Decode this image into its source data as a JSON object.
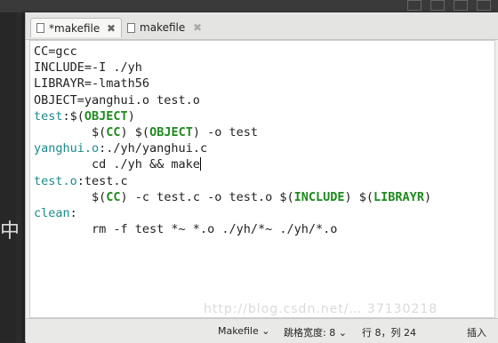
{
  "background": {
    "left_glyph": "中"
  },
  "tabs": [
    {
      "label": "*makefile",
      "active": true
    },
    {
      "label": "makefile",
      "active": false
    }
  ],
  "editor": {
    "lines": [
      [
        {
          "t": "CC=gcc",
          "k": "plain"
        }
      ],
      [
        {
          "t": "INCLUDE=-I ./yh",
          "k": "plain"
        }
      ],
      [
        {
          "t": "LIBRAYR=-lmath56",
          "k": "plain"
        }
      ],
      [
        {
          "t": "OBJECT=yanghui.o test.o",
          "k": "plain"
        }
      ],
      [
        {
          "t": "test",
          "k": "target"
        },
        {
          "t": ":$(",
          "k": "plain"
        },
        {
          "t": "OBJECT",
          "k": "var"
        },
        {
          "t": ")",
          "k": "plain"
        }
      ],
      [
        {
          "t": "        $(",
          "k": "plain"
        },
        {
          "t": "CC",
          "k": "var"
        },
        {
          "t": ") $(",
          "k": "plain"
        },
        {
          "t": "OBJECT",
          "k": "var"
        },
        {
          "t": ") -o test",
          "k": "plain"
        }
      ],
      [
        {
          "t": "yanghui.o",
          "k": "target"
        },
        {
          "t": ":./yh/yanghui.c",
          "k": "plain"
        }
      ],
      [
        {
          "t": "        cd ./yh && make",
          "k": "plain"
        },
        {
          "caret": true
        }
      ],
      [
        {
          "t": "test.o",
          "k": "target"
        },
        {
          "t": ":test.c",
          "k": "plain"
        }
      ],
      [
        {
          "t": "        $(",
          "k": "plain"
        },
        {
          "t": "CC",
          "k": "var"
        },
        {
          "t": ") -c test.c -o test.o $(",
          "k": "plain"
        },
        {
          "t": "INCLUDE",
          "k": "var"
        },
        {
          "t": ") $(",
          "k": "plain"
        },
        {
          "t": "LIBRAYR",
          "k": "var"
        },
        {
          "t": ")",
          "k": "plain"
        }
      ],
      [
        {
          "t": "clean",
          "k": "target"
        },
        {
          "t": ":",
          "k": "plain"
        }
      ],
      [
        {
          "t": "        rm -f test *~ *.o ./yh/*~ ./yh/*.o",
          "k": "plain"
        }
      ]
    ]
  },
  "statusbar": {
    "language": "Makefile ⌄",
    "tab_width": "跳格宽度: 8 ⌄",
    "position": "行 8，列 24",
    "mode": "插入"
  },
  "watermark": "http://blog.csdn.net/… 37130218",
  "colors": {
    "target": "#1a8a8a",
    "variable": "#1f8a1f",
    "text": "#222222"
  }
}
